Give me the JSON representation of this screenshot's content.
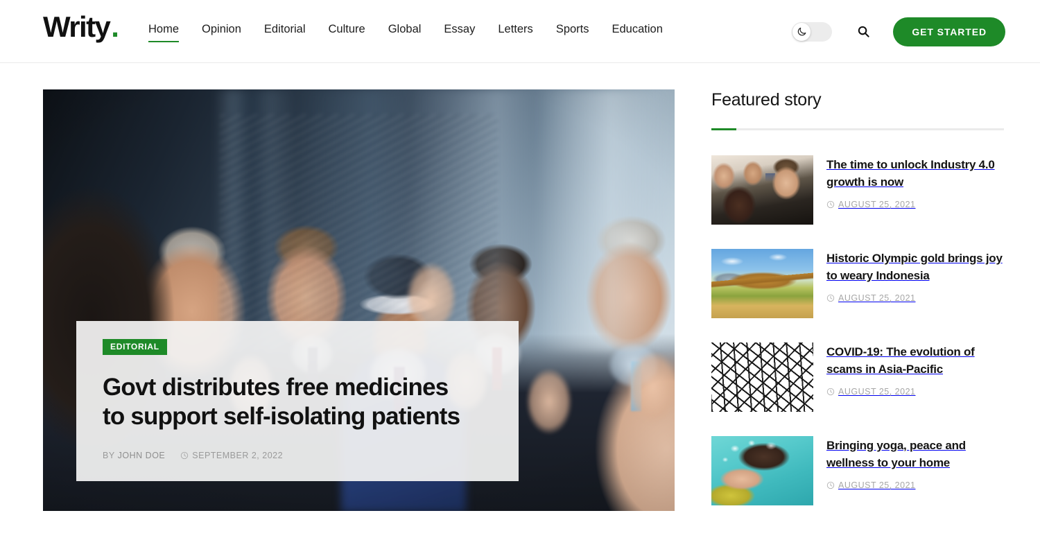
{
  "header": {
    "brand": {
      "name": "Writy",
      "dot": "."
    },
    "nav": [
      {
        "label": "Home",
        "active": true
      },
      {
        "label": "Opinion",
        "active": false
      },
      {
        "label": "Editorial",
        "active": false
      },
      {
        "label": "Culture",
        "active": false
      },
      {
        "label": "Global",
        "active": false
      },
      {
        "label": "Essay",
        "active": false
      },
      {
        "label": "Letters",
        "active": false
      },
      {
        "label": "Sports",
        "active": false
      },
      {
        "label": "Education",
        "active": false
      }
    ],
    "theme_toggle": {
      "icon": "moon-icon",
      "state": "light"
    },
    "search": {
      "icon": "search-icon"
    },
    "cta": {
      "label": "GET STARTED",
      "color": "#1e8a28"
    }
  },
  "hero": {
    "category": "EDITORIAL",
    "title": "Govt distributes free medicines to support self-isolating patients",
    "title_line_1": "Govt distributes free medicines",
    "title_line_2": "to support self-isolating patients",
    "byline_prefix": "BY",
    "author": "JOHN DOE",
    "date": "SEPTEMBER 2, 2022",
    "date_icon": "clock-icon",
    "image_alt": "Group of business people applauding a man wearing a VR headset"
  },
  "sidebar": {
    "title": "Featured story",
    "accent_color": "#1e8a28",
    "stories": [
      {
        "title": "The time to unlock Industry 4.0 growth is now",
        "date": "AUGUST 25, 2021",
        "date_icon": "clock-icon",
        "thumb_class": "thumb-1",
        "image_alt": "Man in suit speaking with journalists"
      },
      {
        "title": "Historic Olympic gold brings joy to weary Indonesia",
        "date": "AUGUST 25, 2021",
        "date_icon": "clock-icon",
        "thumb_class": "thumb-2",
        "image_alt": "Olympic velodrome stadium on a sunny day"
      },
      {
        "title": "COVID-19: The evolution of scams in Asia-Pacific",
        "date": "AUGUST 25, 2021",
        "date_icon": "clock-icon",
        "thumb_class": "thumb-3",
        "image_alt": "Hand drawn COVID-19 lettering pattern"
      },
      {
        "title": "Bringing yoga, peace and wellness to your home",
        "date": "AUGUST 25, 2021",
        "date_icon": "clock-icon",
        "thumb_class": "thumb-4",
        "image_alt": "Woman floating underwater in a pool"
      }
    ]
  },
  "colors": {
    "brand_green": "#1e8a28",
    "text_dark": "#141414",
    "muted": "#a6a6a6",
    "border": "#e9e9e9"
  }
}
